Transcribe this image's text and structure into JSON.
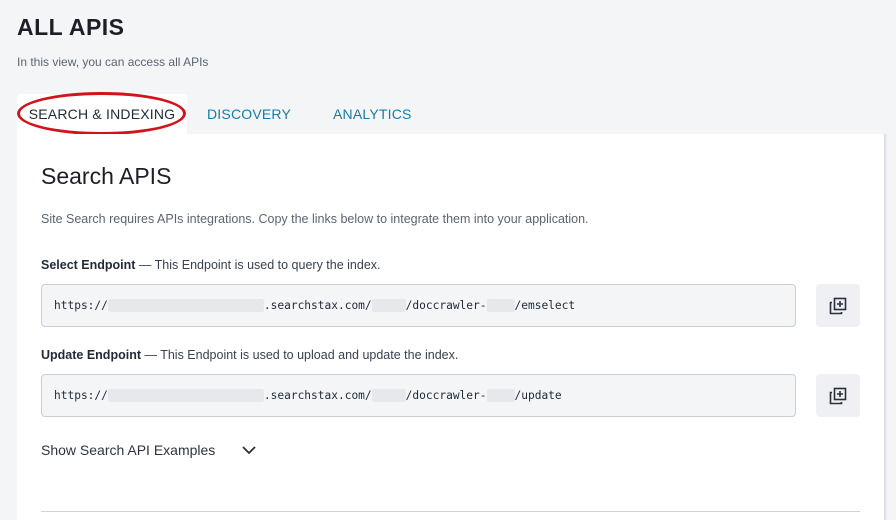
{
  "page": {
    "title": "ALL APIS",
    "subtitle": "In this view, you can access all APIs"
  },
  "tabs": [
    {
      "label": "SEARCH & INDEXING",
      "active": true
    },
    {
      "label": "DISCOVERY",
      "active": false
    },
    {
      "label": "ANALYTICS",
      "active": false
    }
  ],
  "section": {
    "title": "Search APIS",
    "description": "Site Search requires APIs integrations. Copy the links below to integrate them into your application."
  },
  "select_endpoint": {
    "label": "Select Endpoint",
    "description": " — This Endpoint is used to query the index.",
    "url_prefix": "https://",
    "url_domain": ".searchstax.com/",
    "url_mid": "/doccrawler-",
    "url_suffix": "/emselect"
  },
  "update_endpoint": {
    "label": "Update Endpoint",
    "description": " — This Endpoint is used to upload and update the index.",
    "url_prefix": "https://",
    "url_domain": ".searchstax.com/",
    "url_mid": "/doccrawler-",
    "url_suffix": "/update"
  },
  "examples": {
    "label": "Show Search API Examples",
    "icon": "chevron-down-icon"
  },
  "colors": {
    "accent": "#1a7aa8",
    "highlight": "#d3121b",
    "background": "#f4f5f7"
  }
}
